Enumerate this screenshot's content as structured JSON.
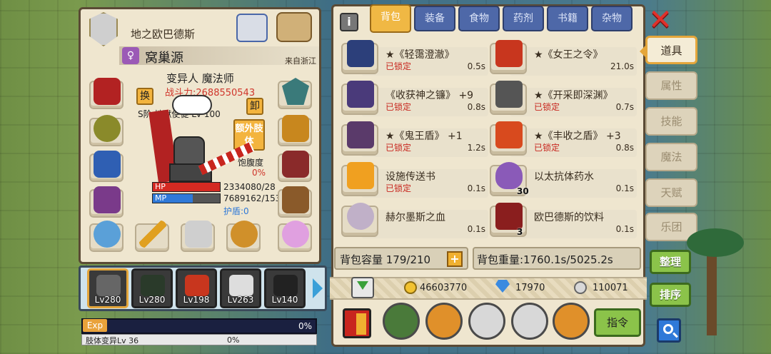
{
  "character": {
    "guild": "地之欧巴德斯",
    "name": "窝巢源",
    "region": "来自浙江",
    "class": "变异人 魔法师",
    "power": "战斗力:2688550543",
    "title": "S阶 地狱使徒 Lv 100",
    "btn_swap": "换",
    "btn_unequip": "卸",
    "btn_extra_limb": "额外肢体",
    "satiety_label": "饱腹度",
    "satiety_value": "0%",
    "hp_label": "HP",
    "hp_value": "2334080/28",
    "mp_label": "MP",
    "mp_value": "7689162/153",
    "shield": "护盾:0",
    "exp_label": "Exp",
    "exp_percent": "0%",
    "limb_label": "肢体变异Lv 36",
    "limb_percent": "0%"
  },
  "team": [
    {
      "level": "Lv280"
    },
    {
      "level": "Lv280"
    },
    {
      "level": "Lv198"
    },
    {
      "level": "Lv263"
    },
    {
      "level": "Lv140"
    }
  ],
  "tabs": [
    "背包",
    "装备",
    "食物",
    "药剂",
    "书籍",
    "杂物"
  ],
  "items": [
    {
      "name": "★《轻霭澄澈》",
      "lock": "已锁定",
      "time": "0.5s",
      "qty": ""
    },
    {
      "name": "★《女王之令》",
      "lock": "",
      "time": "21.0s",
      "qty": ""
    },
    {
      "name": "《收获神之镰》 +9",
      "lock": "已锁定",
      "time": "0.8s",
      "qty": ""
    },
    {
      "name": "★《开采即深渊》",
      "lock": "已锁定",
      "time": "0.7s",
      "qty": ""
    },
    {
      "name": "★《鬼王盾》 +1",
      "lock": "已锁定",
      "time": "1.2s",
      "qty": ""
    },
    {
      "name": "★《丰收之盾》 +3",
      "lock": "已锁定",
      "time": "0.8s",
      "qty": ""
    },
    {
      "name": "设施传送书",
      "lock": "已锁定",
      "time": "0.1s",
      "qty": ""
    },
    {
      "name": "以太抗体药水",
      "lock": "",
      "time": "0.1s",
      "qty": "30"
    },
    {
      "name": "赫尔墨斯之血",
      "lock": "",
      "time": "0.1s",
      "qty": ""
    },
    {
      "name": "欧巴德斯的饮料",
      "lock": "",
      "time": "0.1s",
      "qty": "3"
    }
  ],
  "capacity": "背包容量 179/210",
  "weight": "背包重量:1760.1s/5025.2s",
  "currency": {
    "gold": "46603770",
    "diamond": "17970",
    "silver": "110071"
  },
  "command_btn": "指令",
  "side_tabs": [
    "道具",
    "属性",
    "技能",
    "魔法",
    "天赋",
    "乐团"
  ],
  "organize_btn": "整理",
  "sort_btn": "排序",
  "colors": {
    "accent": "#f0b844",
    "tab_blue": "#4e68a8",
    "lock_red": "#c8261e",
    "green_btn": "#8bc34a"
  }
}
